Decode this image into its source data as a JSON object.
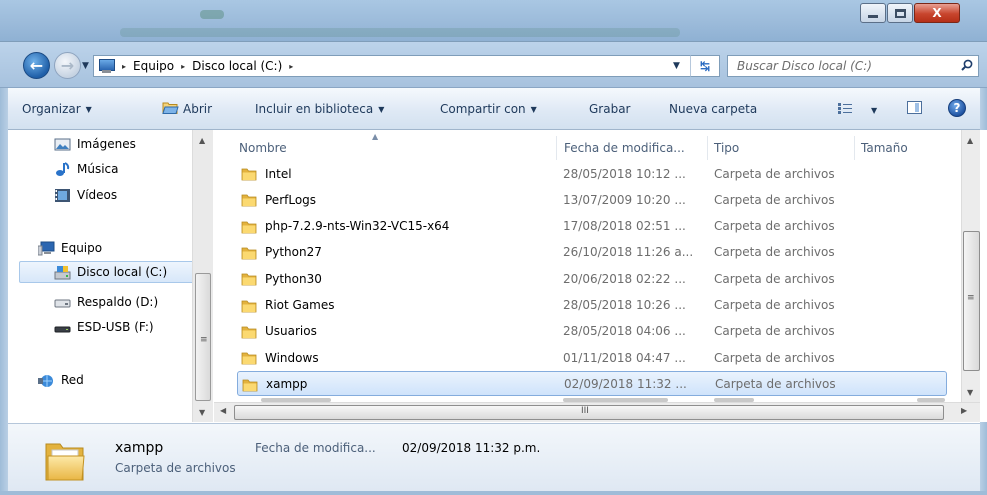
{
  "window": {
    "controls": {
      "minimize_icon": "minimize-icon",
      "maximize_icon": "maximize-icon",
      "close_glyph": "X"
    }
  },
  "address_bar": {
    "crumbs": [
      "Equipo",
      "Disco local (C:)"
    ],
    "separator": "▸"
  },
  "search": {
    "placeholder": "Buscar Disco local (C:)"
  },
  "toolbar": {
    "organize": "Organizar",
    "open": "Abrir",
    "include_library": "Incluir en biblioteca",
    "share_with": "Compartir con",
    "burn": "Grabar",
    "new_folder": "Nueva carpeta",
    "caret": "▼"
  },
  "nav": {
    "items": [
      {
        "label": "Imágenes",
        "icon": "pictures-icon"
      },
      {
        "label": "Música",
        "icon": "music-icon"
      },
      {
        "label": "Vídeos",
        "icon": "videos-icon"
      },
      {
        "label": "Equipo",
        "icon": "computer-icon"
      },
      {
        "label": "Disco local (C:)",
        "icon": "local-disk-icon"
      },
      {
        "label": "Respaldo (D:)",
        "icon": "drive-icon"
      },
      {
        "label": "ESD-USB (F:)",
        "icon": "usb-drive-icon"
      },
      {
        "label": "Red",
        "icon": "network-icon"
      }
    ]
  },
  "columns": {
    "name": "Nombre",
    "modified": "Fecha de modifica...",
    "type": "Tipo",
    "size": "Tamaño"
  },
  "files": [
    {
      "name": "Intel",
      "modified": "28/05/2018 10:12 ...",
      "type": "Carpeta de archivos"
    },
    {
      "name": "PerfLogs",
      "modified": "13/07/2009 10:20 ...",
      "type": "Carpeta de archivos"
    },
    {
      "name": "php-7.2.9-nts-Win32-VC15-x64",
      "modified": "17/08/2018 02:51 ...",
      "type": "Carpeta de archivos"
    },
    {
      "name": "Python27",
      "modified": "26/10/2018 11:26 a...",
      "type": "Carpeta de archivos"
    },
    {
      "name": "Python30",
      "modified": "20/06/2018 02:22 ...",
      "type": "Carpeta de archivos"
    },
    {
      "name": "Riot Games",
      "modified": "28/05/2018 10:26 ...",
      "type": "Carpeta de archivos"
    },
    {
      "name": "Usuarios",
      "modified": "28/05/2018 04:06 ...",
      "type": "Carpeta de archivos"
    },
    {
      "name": "Windows",
      "modified": "01/11/2018 04:47 ...",
      "type": "Carpeta de archivos"
    },
    {
      "name": "xampp",
      "modified": "02/09/2018 11:32 ...",
      "type": "Carpeta de archivos",
      "selected": true
    }
  ],
  "scroll": {
    "grip": "III"
  },
  "details": {
    "name": "xampp",
    "type": "Carpeta de archivos",
    "date_label": "Fecha de modifica...",
    "date_value": "02/09/2018 11:32 p.m."
  },
  "colors": {
    "accent": "#1f5fa8",
    "selection": "#cfe3fb",
    "folder": "#e8b43c"
  }
}
